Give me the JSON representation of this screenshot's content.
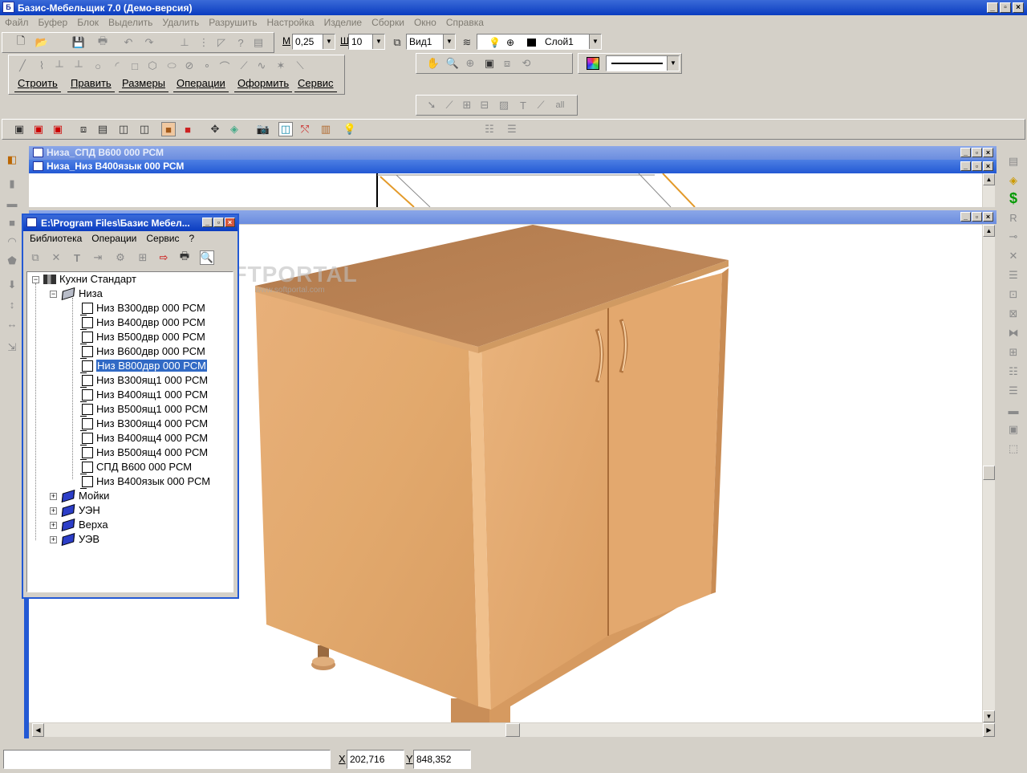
{
  "app": {
    "title": "Базис-Мебельщик 7.0 (Демо-версия)",
    "icon": "app-logo-icon"
  },
  "menu": [
    "Файл",
    "Буфер",
    "Блок",
    "Выделить",
    "Удалить",
    "Разрушить",
    "Настройка",
    "Изделие",
    "Сборки",
    "Окно",
    "Справка"
  ],
  "toolbar": {
    "step_prefix": "М",
    "step_value": "0,25",
    "grid_prefix": "Ш",
    "grid_value": "10",
    "view_value": "Вид1",
    "layer_value": "Слой1"
  },
  "tabs": [
    "Строить",
    "Править",
    "Размеры",
    "Операции",
    "Оформить",
    "Сервис"
  ],
  "windows": {
    "back_title": "Низа_СПД В600 000 РСМ",
    "front_title": "Низа_Низ В400язык 000 РСМ"
  },
  "library": {
    "title": "E:\\Program Files\\Базис Мебел...",
    "menu": [
      "Библиотека",
      "Операции",
      "Сервис",
      "?"
    ],
    "root": "Кухни Стандарт",
    "group_open": "Низа",
    "items": [
      "Низ В300двр 000 РСМ",
      "Низ В400двр 000 РСМ",
      "Низ В500двр 000 РСМ",
      "Низ В600двр 000 РСМ",
      "Низ В800двр 000 РСМ",
      "Низ В300ящ1 000 РСМ",
      "Низ В400ящ1 000 РСМ",
      "Низ В500ящ1 000 РСМ",
      "Низ В300ящ4 000 РСМ",
      "Низ В400ящ4 000 РСМ",
      "Низ В500ящ4 000 РСМ",
      "СПД В600 000 РСМ",
      "Низ В400язык 000 РСМ"
    ],
    "selected_index": 4,
    "groups_closed": [
      "Мойки",
      "УЭН",
      "Верха",
      "УЭВ"
    ]
  },
  "watermark": {
    "brand": "SOFTPORTAL",
    "url": "www.softportal.com"
  },
  "status": {
    "x_label": "X",
    "x_value": "202,716",
    "y_label": "Y",
    "y_value": "848,352"
  },
  "colors": {
    "title_bar": "#0a3cc0",
    "selection": "#316ac5",
    "wood": "#e4aa6f",
    "wood_top": "#b8845a"
  }
}
